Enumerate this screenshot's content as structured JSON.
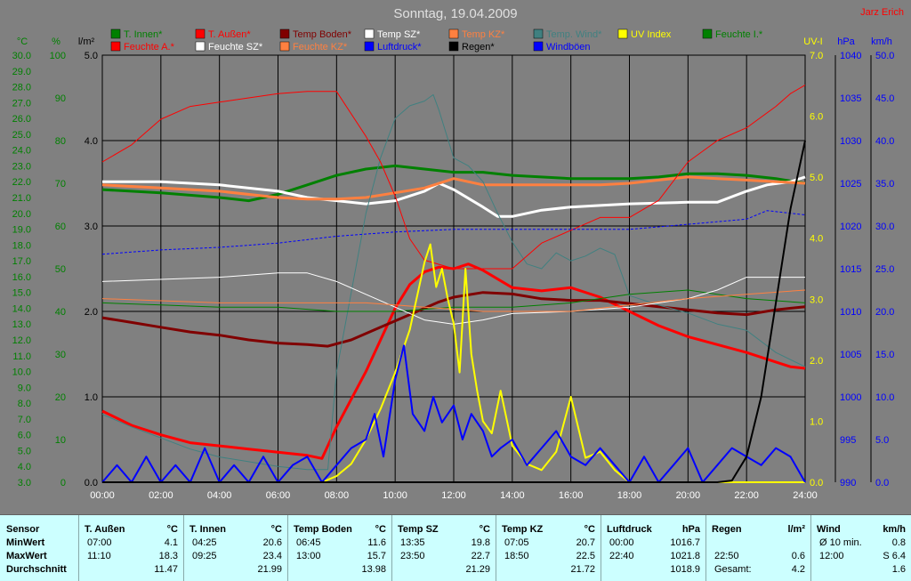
{
  "author": "Jarz Erich",
  "chart_data": {
    "type": "line",
    "title": "Sonntag, 19.04.2009",
    "x_ticks": [
      "00:00",
      "02:00",
      "04:00",
      "06:00",
      "08:00",
      "10:00",
      "12:00",
      "14:00",
      "16:00",
      "18:00",
      "20:00",
      "22:00",
      "24:00"
    ],
    "axes": {
      "temp": {
        "unit": "°C",
        "ticks": [
          "30.0",
          "29.0",
          "28.0",
          "27.0",
          "26.0",
          "25.0",
          "24.0",
          "23.0",
          "22.0",
          "21.0",
          "20.0",
          "19.0",
          "18.0",
          "17.0",
          "16.0",
          "15.0",
          "14.0",
          "13.0",
          "12.0",
          "11.0",
          "10.0",
          "9.0",
          "8.0",
          "7.0",
          "6.0",
          "5.0",
          "4.0",
          "3.0"
        ],
        "ylim": [
          3,
          30
        ]
      },
      "humidity": {
        "unit": "%",
        "ticks": [
          "100",
          "90",
          "80",
          "70",
          "60",
          "50",
          "40",
          "30",
          "20",
          "10",
          "0"
        ],
        "ylim": [
          0,
          100
        ]
      },
      "rain": {
        "unit": "l/m²",
        "ticks": [
          "5.0",
          "4.0",
          "3.0",
          "2.0",
          "1.0",
          "0.0"
        ],
        "ylim": [
          0,
          5
        ]
      },
      "uv": {
        "unit": "UV-I",
        "ticks": [
          "7.0",
          "6.0",
          "5.0",
          "4.0",
          "3.0",
          "2.0",
          "1.0",
          "0.0"
        ],
        "ylim": [
          0,
          7
        ]
      },
      "pressure": {
        "unit": "hPa",
        "ticks": [
          "1040",
          "1035",
          "1030",
          "1025",
          "1020",
          "1015",
          "1010",
          "1005",
          "1000",
          "995",
          "990"
        ],
        "ylim": [
          990,
          1040
        ]
      },
      "wind": {
        "unit": "km/h",
        "ticks": [
          "50.0",
          "45.0",
          "40.0",
          "35.0",
          "30.0",
          "25.0",
          "20.0",
          "15.0",
          "10.0",
          "5.0",
          "0.0"
        ],
        "ylim": [
          0,
          50
        ]
      }
    },
    "legend": [
      {
        "name": "T. Innen*",
        "color": "#008000"
      },
      {
        "name": "T. Außen*",
        "color": "#ff0000"
      },
      {
        "name": "Temp Boden*",
        "color": "#800000"
      },
      {
        "name": "Temp SZ*",
        "color": "#ffffff"
      },
      {
        "name": "Temp KZ*",
        "color": "#ff8040"
      },
      {
        "name": "Temp. Wind*",
        "color": "#408080"
      },
      {
        "name": "UV Index",
        "color": "#ffff00"
      },
      {
        "name": "Feuchte I.*",
        "color": "#008000"
      },
      {
        "name": "Feuchte A.*",
        "color": "#ff0000"
      },
      {
        "name": "Feuchte SZ*",
        "color": "#ffffff"
      },
      {
        "name": "Feuchte KZ*",
        "color": "#ff8040"
      },
      {
        "name": "Luftdruck*",
        "color": "#0000ff"
      },
      {
        "name": "Regen*",
        "color": "#000000"
      },
      {
        "name": "Windböen",
        "color": "#0000ff"
      }
    ],
    "series": [
      {
        "name": "T. Außen*",
        "axis": "temp",
        "color": "#ff0000",
        "width": 3,
        "x": [
          0,
          1,
          2,
          3,
          4,
          5,
          6,
          7,
          7.5,
          8,
          9,
          10,
          10.5,
          11,
          11.5,
          12,
          12.5,
          13,
          14,
          15,
          16,
          17,
          18,
          19,
          20,
          21,
          22,
          23,
          23.5,
          24
        ],
        "y": [
          7.5,
          6.6,
          6.0,
          5.5,
          5.3,
          5.1,
          4.9,
          4.7,
          4.5,
          6.5,
          10.0,
          14.0,
          15.5,
          16.3,
          16.6,
          16.5,
          16.8,
          16.4,
          15.3,
          15.1,
          15.3,
          14.7,
          13.8,
          12.9,
          12.2,
          11.7,
          11.2,
          10.6,
          10.3,
          10.2
        ]
      },
      {
        "name": "T. Innen*",
        "axis": "temp",
        "color": "#008000",
        "width": 3,
        "x": [
          0,
          2,
          4,
          5,
          6,
          7,
          8,
          9,
          10,
          11,
          12,
          13,
          14,
          16,
          18,
          19,
          20,
          21,
          22,
          23,
          24
        ],
        "y": [
          21.5,
          21.3,
          21.0,
          20.8,
          21.2,
          21.8,
          22.4,
          22.8,
          23.0,
          22.8,
          22.6,
          22.6,
          22.4,
          22.2,
          22.2,
          22.3,
          22.5,
          22.5,
          22.4,
          22.2,
          21.9
        ]
      },
      {
        "name": "Temp Boden*",
        "axis": "temp",
        "color": "#800000",
        "width": 3,
        "x": [
          0,
          1,
          2,
          3,
          4,
          5,
          6,
          7,
          7.7,
          8.5,
          9.5,
          10.5,
          11.5,
          12,
          13,
          14,
          15,
          16,
          17,
          18,
          19,
          20,
          21,
          22,
          23,
          24
        ],
        "y": [
          13.4,
          13.1,
          12.8,
          12.5,
          12.3,
          12.0,
          11.8,
          11.7,
          11.6,
          12.0,
          12.8,
          13.6,
          14.4,
          14.7,
          15.0,
          14.9,
          14.6,
          14.5,
          14.5,
          14.3,
          14.1,
          13.9,
          13.7,
          13.6,
          13.9,
          14.1
        ]
      },
      {
        "name": "Temp SZ*",
        "axis": "temp",
        "color": "#ffffff",
        "width": 3,
        "x": [
          0,
          2,
          4,
          6,
          7,
          8,
          9,
          10,
          11,
          11.5,
          12,
          13,
          13.5,
          14,
          15,
          16,
          17,
          18,
          20,
          21,
          22,
          22.7,
          23.5,
          24
        ],
        "y": [
          22.0,
          22.0,
          21.8,
          21.4,
          21.0,
          20.8,
          20.6,
          20.8,
          21.4,
          21.9,
          21.5,
          20.4,
          19.8,
          19.8,
          20.2,
          20.4,
          20.5,
          20.6,
          20.7,
          20.7,
          21.4,
          21.8,
          22.0,
          22.3
        ]
      },
      {
        "name": "Temp KZ*",
        "axis": "temp",
        "color": "#ff8040",
        "width": 3,
        "x": [
          0,
          2,
          4,
          6,
          7,
          8,
          9,
          10,
          11,
          12,
          13,
          14,
          15,
          16,
          17,
          18,
          19,
          20,
          21,
          22,
          23,
          24
        ],
        "y": [
          21.8,
          21.6,
          21.4,
          21.0,
          20.9,
          20.9,
          21.0,
          21.3,
          21.6,
          22.2,
          21.8,
          21.8,
          21.8,
          21.8,
          21.8,
          21.9,
          22.1,
          22.3,
          22.2,
          22.1,
          22.0,
          21.9
        ]
      },
      {
        "name": "Temp. Wind*",
        "axis": "temp",
        "color": "#408080",
        "width": 1,
        "x": [
          0,
          1,
          2,
          3,
          4,
          5,
          6,
          7,
          7.7,
          8,
          9,
          9.5,
          10,
          10.5,
          11,
          11.3,
          11.5,
          12,
          12.5,
          13,
          13.5,
          14,
          14.5,
          15,
          15.5,
          16,
          16.5,
          17,
          17.5,
          18,
          19,
          20,
          21,
          22,
          23,
          24
        ],
        "y": [
          7.3,
          6.5,
          5.8,
          5.1,
          4.6,
          4.3,
          4.0,
          3.8,
          3.8,
          10.0,
          20.0,
          23.5,
          26.0,
          26.8,
          27.1,
          27.5,
          26.5,
          23.5,
          23.0,
          22.0,
          20.0,
          18.2,
          16.8,
          16.5,
          17.5,
          17.0,
          17.3,
          17.8,
          17.4,
          14.8,
          14.2,
          13.7,
          13.0,
          12.6,
          11.2,
          10.3
        ]
      },
      {
        "name": "Feuchte A.*",
        "axis": "humidity",
        "color": "#ff0000",
        "width": 1,
        "x": [
          0,
          1,
          2,
          3,
          4,
          5,
          6,
          7,
          8,
          9,
          9.5,
          10,
          10.5,
          11,
          12,
          13,
          14,
          15,
          16,
          17,
          18,
          19,
          20,
          21,
          22,
          23,
          23.5,
          24
        ],
        "y": [
          75,
          79,
          85,
          88,
          89,
          90,
          91,
          91.5,
          91.5,
          81,
          75,
          67,
          57,
          52,
          50,
          50,
          50,
          56,
          59,
          62,
          62,
          66,
          75,
          80,
          83,
          88,
          91,
          93
        ]
      },
      {
        "name": "Feuchte I.*",
        "axis": "humidity",
        "color": "#008000",
        "width": 1,
        "x": [
          0,
          2,
          4,
          6,
          8,
          10,
          12,
          14,
          16,
          18,
          20,
          22,
          24
        ],
        "y": [
          42,
          41.5,
          41,
          41,
          40,
          40,
          41,
          41,
          42,
          44,
          45,
          43,
          42
        ]
      },
      {
        "name": "Feuchte SZ*",
        "axis": "humidity",
        "color": "#ffffff",
        "width": 1,
        "x": [
          0,
          2,
          4,
          6,
          7,
          8,
          9,
          10,
          11,
          12,
          13,
          14,
          16,
          18,
          20,
          21,
          22,
          23,
          24
        ],
        "y": [
          47,
          47.5,
          48,
          49,
          49,
          47,
          44,
          41,
          38,
          37,
          38,
          39.5,
          40,
          41,
          43,
          45,
          48,
          48,
          48
        ]
      },
      {
        "name": "Feuchte KZ*",
        "axis": "humidity",
        "color": "#ff8040",
        "width": 1,
        "x": [
          0,
          2,
          4,
          6,
          8,
          9,
          10,
          11,
          12,
          13,
          14,
          16,
          18,
          20,
          22,
          24
        ],
        "y": [
          43,
          42.5,
          42,
          42,
          42,
          42,
          41.5,
          41,
          40.5,
          40,
          40,
          40,
          41.5,
          43,
          44,
          45
        ]
      },
      {
        "name": "Luftdruck*",
        "axis": "pressure",
        "color": "#0000ff",
        "width": 1,
        "dashed": true,
        "x": [
          0,
          2,
          4,
          6,
          8,
          10,
          12,
          14,
          16,
          18,
          20,
          22,
          22.7,
          24
        ],
        "y": [
          1016.7,
          1017.2,
          1017.5,
          1018.0,
          1018.8,
          1019.3,
          1019.6,
          1019.6,
          1019.6,
          1019.6,
          1020.2,
          1020.8,
          1021.8,
          1021.3
        ]
      },
      {
        "name": "UV Index",
        "axis": "uv",
        "color": "#ffff00",
        "width": 2,
        "x": [
          0,
          7.5,
          8,
          8.5,
          9,
          9.5,
          10,
          10.5,
          11,
          11.2,
          11.4,
          11.6,
          11.8,
          12,
          12.2,
          12.4,
          12.6,
          12.8,
          13,
          13.3,
          13.6,
          14,
          14.5,
          15,
          15.5,
          16,
          16.5,
          17,
          17.5,
          18,
          18.5,
          24
        ],
        "y": [
          0,
          0,
          0.1,
          0.3,
          0.7,
          1.2,
          1.8,
          2.5,
          3.6,
          3.9,
          3.2,
          3.5,
          3.0,
          2.6,
          1.8,
          3.5,
          2.1,
          1.5,
          1.0,
          0.8,
          1.5,
          0.6,
          0.3,
          0.2,
          0.5,
          1.4,
          0.4,
          0.5,
          0.2,
          0,
          0,
          0
        ]
      },
      {
        "name": "Windböen",
        "axis": "wind",
        "color": "#0000ff",
        "width": 2,
        "x": [
          0,
          0.5,
          1,
          1.5,
          2,
          2.5,
          3,
          3.5,
          4,
          4.5,
          5,
          5.5,
          6,
          6.5,
          7,
          7.5,
          8,
          8.5,
          9,
          9.3,
          9.6,
          10,
          10.3,
          10.6,
          11,
          11.3,
          11.6,
          12,
          12.3,
          12.6,
          13,
          13.3,
          13.6,
          14,
          14.5,
          15,
          15.5,
          16,
          16.5,
          17,
          17.5,
          18,
          18.5,
          19,
          19.5,
          20,
          20.5,
          21,
          21.5,
          22,
          22.5,
          23,
          23.5,
          24
        ],
        "y": [
          0,
          2,
          0,
          3,
          0,
          2,
          0,
          4,
          0,
          2,
          0,
          3,
          0,
          2,
          3,
          0,
          2,
          4,
          5,
          8,
          3,
          12,
          16,
          8,
          6,
          10,
          7,
          9,
          5,
          8,
          6,
          3,
          4,
          5,
          2,
          4,
          6,
          3,
          2,
          4,
          2,
          0,
          3,
          0,
          2,
          4,
          0,
          2,
          4,
          3,
          2,
          4,
          3,
          0
        ]
      },
      {
        "name": "Regen*",
        "axis": "rain",
        "color": "#000000",
        "width": 2,
        "x": [
          0,
          21,
          21.5,
          22,
          22.5,
          23,
          23.5,
          24
        ],
        "y": [
          0,
          0,
          0.02,
          0.3,
          1.0,
          2.1,
          3.2,
          4.0
        ]
      }
    ]
  },
  "stats": {
    "sensor_hdr": "Sensor",
    "row_labels": [
      "MinWert",
      "MaxWert",
      "Durchschnitt"
    ],
    "cols": [
      {
        "name": "T. Außen",
        "unit": "°C",
        "rows": [
          [
            "07:00",
            "4.1"
          ],
          [
            "11:10",
            "18.3"
          ],
          [
            "",
            "11.47"
          ]
        ]
      },
      {
        "name": "T. Innen",
        "unit": "°C",
        "rows": [
          [
            "04:25",
            "20.6"
          ],
          [
            "09:25",
            "23.4"
          ],
          [
            "",
            "21.99"
          ]
        ]
      },
      {
        "name": "Temp Boden",
        "unit": "°C",
        "rows": [
          [
            "06:45",
            "11.6"
          ],
          [
            "13:00",
            "15.7"
          ],
          [
            "",
            "13.98"
          ]
        ]
      },
      {
        "name": "Temp SZ",
        "unit": "°C",
        "rows": [
          [
            "13:35",
            "19.8"
          ],
          [
            "23:50",
            "22.7"
          ],
          [
            "",
            "21.29"
          ]
        ]
      },
      {
        "name": "Temp KZ",
        "unit": "°C",
        "rows": [
          [
            "07:05",
            "20.7"
          ],
          [
            "18:50",
            "22.5"
          ],
          [
            "",
            "21.72"
          ]
        ]
      },
      {
        "name": "Luftdruck",
        "unit": "hPa",
        "rows": [
          [
            "00:00",
            "1016.7"
          ],
          [
            "22:40",
            "1021.8"
          ],
          [
            "",
            "1018.9"
          ]
        ]
      },
      {
        "name": "Regen",
        "unit": "l/m²",
        "rows": [
          [
            "",
            ""
          ],
          [
            "22:50",
            "0.6"
          ],
          [
            "Gesamt:",
            "4.2"
          ]
        ]
      },
      {
        "name": "Wind",
        "unit": "km/h",
        "rows": [
          [
            "Ø 10 min.",
            "0.8"
          ],
          [
            "12:00",
            "S 6.4"
          ],
          [
            "",
            "1.6"
          ]
        ]
      }
    ]
  }
}
